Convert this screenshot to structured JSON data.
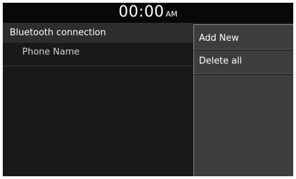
{
  "status_bar": {
    "time": "00:00",
    "ampm": "AM"
  },
  "list": {
    "header": "Bluetooth connection",
    "items": [
      {
        "label": "Phone Name"
      }
    ]
  },
  "menu": {
    "items": [
      {
        "label": "Add New"
      },
      {
        "label": "Delete all"
      }
    ]
  }
}
